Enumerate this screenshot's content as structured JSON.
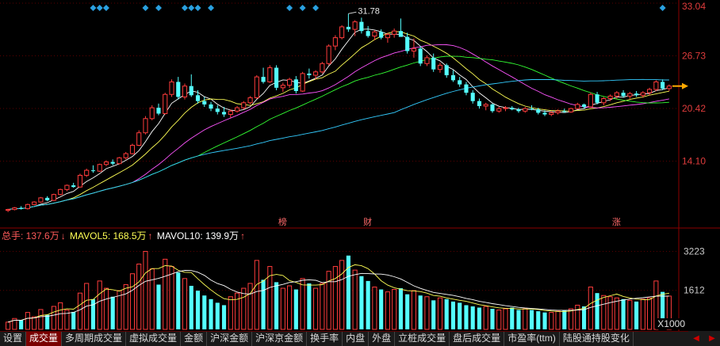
{
  "price_panel": {
    "y_ticks": [
      "33.04",
      "26.73",
      "20.42",
      "14.10"
    ],
    "y_values": [
      33.04,
      26.73,
      20.42,
      14.1
    ],
    "y_range": [
      7.6,
      33.04
    ],
    "high_marker": "31.78",
    "event_labels": [
      {
        "text": "榜",
        "index": 42
      },
      {
        "text": "财",
        "index": 55
      },
      {
        "text": "涨",
        "index": 93
      }
    ],
    "diamond_indices": [
      13,
      14,
      15,
      21,
      23,
      27,
      28,
      29,
      31,
      43,
      45,
      47,
      100
    ],
    "ma_colors": {
      "ma5": "#ffffff",
      "ma10": "#ffff55",
      "ma20": "#ff55ff",
      "ma30": "#33ff33",
      "ma60": "#33ccff"
    },
    "up_color": "#ff3c3c",
    "down_color": "#54ffff",
    "arrow_color": "#ffaa00"
  },
  "volume_panel": {
    "header": {
      "total_label": "总手: 137.6万",
      "total_arrow": "↓",
      "ma5_label": "MAVOL5: 168.5万",
      "ma5_arrow": "↑",
      "ma10_label": "MAVOL10: 139.9万",
      "ma10_arrow": "↑"
    },
    "y_ticks": [
      "3223",
      "1612"
    ],
    "y_values": [
      3223,
      1612
    ],
    "scale": "X1000"
  },
  "tabs": [
    "设置",
    "成交量",
    "多周期成交量",
    "虚拟成交量",
    "金额",
    "沪深金额",
    "沪深京金额",
    "换手率",
    "内盘",
    "外盘",
    "立桩成交量",
    "盘后成交量",
    "市盈率(ttm)",
    "陆股通持股变化"
  ],
  "active_tab": 1,
  "chart_data": {
    "type": "candlestick",
    "ylim": [
      7.6,
      33.04
    ],
    "vol_ylim": [
      0,
      3600
    ],
    "candles": [
      [
        8.2,
        8.4,
        8.0,
        8.3
      ],
      [
        8.3,
        8.6,
        8.2,
        8.5
      ],
      [
        8.5,
        8.7,
        8.3,
        8.4
      ],
      [
        8.4,
        9.0,
        8.3,
        8.9
      ],
      [
        8.9,
        9.3,
        8.8,
        9.2
      ],
      [
        9.2,
        9.8,
        9.1,
        9.7
      ],
      [
        9.7,
        9.9,
        9.3,
        9.4
      ],
      [
        9.4,
        10.2,
        9.3,
        10.1
      ],
      [
        10.1,
        10.8,
        10.0,
        10.7
      ],
      [
        10.7,
        11.3,
        10.5,
        11.2
      ],
      [
        11.2,
        11.5,
        10.9,
        11.0
      ],
      [
        11.0,
        12.6,
        10.9,
        12.4
      ],
      [
        12.4,
        13.2,
        12.2,
        13.0
      ],
      [
        13.0,
        13.6,
        12.7,
        12.9
      ],
      [
        12.9,
        13.8,
        12.8,
        13.7
      ],
      [
        13.7,
        14.2,
        13.5,
        14.0
      ],
      [
        14.0,
        14.3,
        13.6,
        13.8
      ],
      [
        13.8,
        14.6,
        13.7,
        14.5
      ],
      [
        14.5,
        15.2,
        14.3,
        15.0
      ],
      [
        15.0,
        16.2,
        14.9,
        16.0
      ],
      [
        16.0,
        17.8,
        15.9,
        17.5
      ],
      [
        17.5,
        19.5,
        17.3,
        19.2
      ],
      [
        19.2,
        20.8,
        19.0,
        20.5
      ],
      [
        20.5,
        21.0,
        19.6,
        19.8
      ],
      [
        19.8,
        22.3,
        19.7,
        22.1
      ],
      [
        22.1,
        23.9,
        21.8,
        23.6
      ],
      [
        23.6,
        24.2,
        21.5,
        21.8
      ],
      [
        21.8,
        23.4,
        21.5,
        23.1
      ],
      [
        23.1,
        24.5,
        21.8,
        22.0
      ],
      [
        22.0,
        22.6,
        21.0,
        21.3
      ],
      [
        21.3,
        21.8,
        20.6,
        20.9
      ],
      [
        20.9,
        21.2,
        20.1,
        20.4
      ],
      [
        20.4,
        20.8,
        19.7,
        20.0
      ],
      [
        20.0,
        20.6,
        19.4,
        19.7
      ],
      [
        19.7,
        20.3,
        19.3,
        20.1
      ],
      [
        20.1,
        20.7,
        19.9,
        20.5
      ],
      [
        20.5,
        21.3,
        20.3,
        21.1
      ],
      [
        21.1,
        21.9,
        20.9,
        21.7
      ],
      [
        21.7,
        24.4,
        21.6,
        24.2
      ],
      [
        24.2,
        25.3,
        23.4,
        23.6
      ],
      [
        23.6,
        25.6,
        23.5,
        25.3
      ],
      [
        25.3,
        25.6,
        22.6,
        22.9
      ],
      [
        22.9,
        23.5,
        22.4,
        23.2
      ],
      [
        23.2,
        24.1,
        22.9,
        23.9
      ],
      [
        23.9,
        24.3,
        22.2,
        22.5
      ],
      [
        22.5,
        24.8,
        22.4,
        24.6
      ],
      [
        24.6,
        25.2,
        24.0,
        24.4
      ],
      [
        24.4,
        25.0,
        23.9,
        24.8
      ],
      [
        24.8,
        26.0,
        24.6,
        25.8
      ],
      [
        25.8,
        28.1,
        25.6,
        27.9
      ],
      [
        27.9,
        29.2,
        27.4,
        28.9
      ],
      [
        28.9,
        30.4,
        28.7,
        30.2
      ],
      [
        30.2,
        31.78,
        29.6,
        29.9
      ],
      [
        29.9,
        31.0,
        29.1,
        30.8
      ],
      [
        30.8,
        31.3,
        29.4,
        29.7
      ],
      [
        29.7,
        30.3,
        28.9,
        29.1
      ],
      [
        29.1,
        29.8,
        28.6,
        29.6
      ],
      [
        29.6,
        29.9,
        28.7,
        28.9
      ],
      [
        28.9,
        29.5,
        28.3,
        29.3
      ],
      [
        29.3,
        30.0,
        28.9,
        29.7
      ],
      [
        29.7,
        31.2,
        29.2,
        29.0
      ],
      [
        29.0,
        29.5,
        27.0,
        27.3
      ],
      [
        27.3,
        28.8,
        26.5,
        27.6
      ],
      [
        27.6,
        27.9,
        25.5,
        25.8
      ],
      [
        25.8,
        26.8,
        25.5,
        26.5
      ],
      [
        26.5,
        27.0,
        24.8,
        25.1
      ],
      [
        25.1,
        25.9,
        24.7,
        25.6
      ],
      [
        25.6,
        25.8,
        24.1,
        24.4
      ],
      [
        24.4,
        25.0,
        23.6,
        23.8
      ],
      [
        23.8,
        24.2,
        23.0,
        23.3
      ],
      [
        23.3,
        23.6,
        22.0,
        22.3
      ],
      [
        22.3,
        22.6,
        21.0,
        21.3
      ],
      [
        21.3,
        21.6,
        20.4,
        20.7
      ],
      [
        20.7,
        21.1,
        20.2,
        20.9
      ],
      [
        20.9,
        21.0,
        19.9,
        20.1
      ],
      [
        20.1,
        20.6,
        19.9,
        20.4
      ],
      [
        20.4,
        20.7,
        20.1,
        20.5
      ],
      [
        20.5,
        20.7,
        20.2,
        20.3
      ],
      [
        20.3,
        20.5,
        19.9,
        20.1
      ],
      [
        20.1,
        20.6,
        19.9,
        20.4
      ],
      [
        20.4,
        20.8,
        20.2,
        20.3
      ],
      [
        20.3,
        20.5,
        19.7,
        19.9
      ],
      [
        19.9,
        20.2,
        19.5,
        19.7
      ],
      [
        19.7,
        20.1,
        19.5,
        19.9
      ],
      [
        19.9,
        20.3,
        19.7,
        20.1
      ],
      [
        20.1,
        20.4,
        19.9,
        20.0
      ],
      [
        20.0,
        20.5,
        19.9,
        20.4
      ],
      [
        20.4,
        21.1,
        20.3,
        20.9
      ],
      [
        20.9,
        21.0,
        20.4,
        20.6
      ],
      [
        20.6,
        22.3,
        20.5,
        22.1
      ],
      [
        22.1,
        22.4,
        20.9,
        21.1
      ],
      [
        21.1,
        21.8,
        20.8,
        21.6
      ],
      [
        21.6,
        22.1,
        21.3,
        21.9
      ],
      [
        21.9,
        22.5,
        21.6,
        22.3
      ],
      [
        22.3,
        22.6,
        21.7,
        21.9
      ],
      [
        21.9,
        22.4,
        21.6,
        22.2
      ],
      [
        22.2,
        22.5,
        21.8,
        22.0
      ],
      [
        22.0,
        22.5,
        21.7,
        22.3
      ],
      [
        22.3,
        22.9,
        22.0,
        22.7
      ],
      [
        22.7,
        23.8,
        22.5,
        23.6
      ],
      [
        23.6,
        23.9,
        22.6,
        22.8
      ],
      [
        22.8,
        23.3,
        22.5,
        23.1
      ]
    ],
    "volume": [
      300,
      450,
      380,
      700,
      520,
      820,
      600,
      950,
      1100,
      800,
      720,
      1500,
      1900,
      1250,
      2000,
      1700,
      1350,
      1600,
      1850,
      2300,
      2700,
      3223,
      2500,
      1850,
      2900,
      2600,
      2350,
      2100,
      1800,
      1600,
      1400,
      1250,
      1100,
      1000,
      1350,
      1500,
      1700,
      1900,
      2850,
      2050,
      2600,
      1950,
      1700,
      1800,
      1650,
      2100,
      1900,
      1700,
      1900,
      2400,
      2600,
      2850,
      3050,
      2450,
      2200,
      2000,
      1750,
      1650,
      1550,
      1650,
      1700,
      1450,
      1600,
      1400,
      1350,
      1200,
      1300,
      1250,
      1150,
      1100,
      1000,
      950,
      900,
      950,
      850,
      800,
      850,
      900,
      800,
      850,
      800,
      750,
      700,
      700,
      750,
      800,
      850,
      1000,
      950,
      1750,
      1500,
      1400,
      1350,
      1300,
      1250,
      1200,
      1150,
      1250,
      1300,
      2000,
      1550,
      1376
    ]
  }
}
